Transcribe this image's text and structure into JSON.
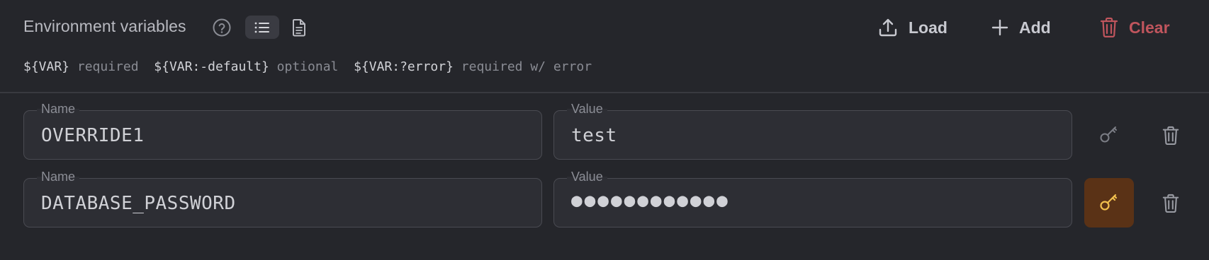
{
  "header": {
    "title": "Environment variables",
    "help_icon": "help-circle-icon",
    "view_list_icon": "list-icon",
    "view_raw_icon": "file-text-icon",
    "actions": {
      "load_label": "Load",
      "add_label": "Add",
      "clear_label": "Clear"
    }
  },
  "syntax_hints": [
    {
      "code": "${VAR}",
      "desc": "required"
    },
    {
      "code": "${VAR:-default}",
      "desc": "optional"
    },
    {
      "code": "${VAR:?error}",
      "desc": "required w/ error"
    }
  ],
  "rows": [
    {
      "name_label": "Name",
      "name": "OVERRIDE1",
      "value_label": "Value",
      "value": "test",
      "secret": false
    },
    {
      "name_label": "Name",
      "name": "DATABASE_PASSWORD",
      "value_label": "Value",
      "value": "●●●●●●●●●●●●",
      "secret": true
    }
  ],
  "colors": {
    "background": "#25262b",
    "clear_red": "#c0555d",
    "secret_active_bg": "#5a3216",
    "secret_key_yellow": "#f2c14e"
  }
}
